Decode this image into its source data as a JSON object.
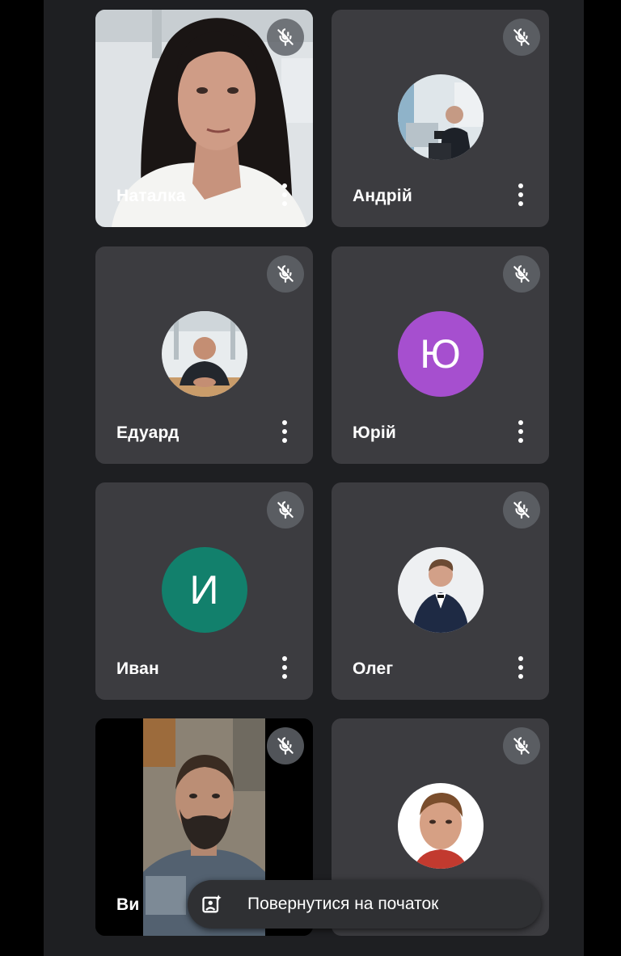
{
  "participants": [
    {
      "name": "Наталка",
      "type": "video",
      "muted": true
    },
    {
      "name": "Андрій",
      "type": "photo-avatar",
      "muted": true
    },
    {
      "name": "Едуард",
      "type": "photo-avatar",
      "muted": true
    },
    {
      "name": "Юрій",
      "type": "letter-avatar",
      "initial": "Ю",
      "color": "#a64fcf",
      "muted": true
    },
    {
      "name": "Иван",
      "type": "letter-avatar",
      "initial": "И",
      "color": "#12806c",
      "muted": true
    },
    {
      "name": "Олег",
      "type": "photo-avatar",
      "muted": true
    },
    {
      "name": "Ви",
      "type": "video",
      "muted": true
    },
    {
      "name": "",
      "type": "photo-avatar",
      "muted": true
    }
  ],
  "toast": {
    "icon": "add-photo-icon",
    "label": "Повернутися на початок"
  },
  "icons": {
    "mute": "mic-off-icon",
    "more": "more-vert-icon"
  },
  "colors": {
    "tile_bg": "#3c3c40",
    "page_bg": "#1e1f22",
    "badge_bg": "#5f6368"
  }
}
